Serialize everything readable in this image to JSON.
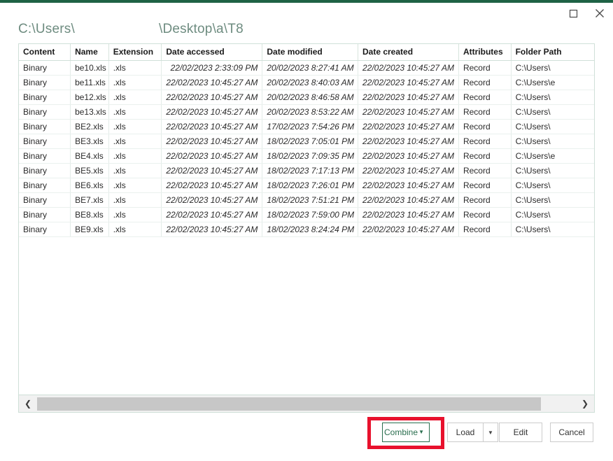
{
  "window": {
    "accent_color": "#1e6245",
    "controls": [
      {
        "name": "maximize",
        "icon": "maximize-icon",
        "label": "Maximize"
      },
      {
        "name": "close",
        "icon": "close-icon",
        "label": "Close"
      }
    ]
  },
  "dialog": {
    "title_prefix": "C:\\Users\\",
    "title_redacted": "",
    "title_suffix": "\\Desktop\\a\\T8",
    "title_color": "#6e8c80"
  },
  "table": {
    "columns": [
      "Content",
      "Name",
      "Extension",
      "Date accessed",
      "Date modified",
      "Date created",
      "Attributes",
      "Folder Path"
    ],
    "rows": [
      {
        "content": "Binary",
        "name": "be10.xls",
        "extension": ".xls",
        "date_accessed": "22/02/2023 2:33:09 PM",
        "date_modified": "20/02/2023 8:27:41 AM",
        "date_created": "22/02/2023 10:45:27 AM",
        "attributes": "Record",
        "folder_path": "C:\\Users\\"
      },
      {
        "content": "Binary",
        "name": "be11.xls",
        "extension": ".xls",
        "date_accessed": "22/02/2023 10:45:27 AM",
        "date_modified": "20/02/2023 8:40:03 AM",
        "date_created": "22/02/2023 10:45:27 AM",
        "attributes": "Record",
        "folder_path": "C:\\Users\\e"
      },
      {
        "content": "Binary",
        "name": "be12.xls",
        "extension": ".xls",
        "date_accessed": "22/02/2023 10:45:27 AM",
        "date_modified": "20/02/2023 8:46:58 AM",
        "date_created": "22/02/2023 10:45:27 AM",
        "attributes": "Record",
        "folder_path": "C:\\Users\\"
      },
      {
        "content": "Binary",
        "name": "be13.xls",
        "extension": ".xls",
        "date_accessed": "22/02/2023 10:45:27 AM",
        "date_modified": "20/02/2023 8:53:22 AM",
        "date_created": "22/02/2023 10:45:27 AM",
        "attributes": "Record",
        "folder_path": "C:\\Users\\"
      },
      {
        "content": "Binary",
        "name": "BE2.xls",
        "extension": ".xls",
        "date_accessed": "22/02/2023 10:45:27 AM",
        "date_modified": "17/02/2023 7:54:26 PM",
        "date_created": "22/02/2023 10:45:27 AM",
        "attributes": "Record",
        "folder_path": "C:\\Users\\"
      },
      {
        "content": "Binary",
        "name": "BE3.xls",
        "extension": ".xls",
        "date_accessed": "22/02/2023 10:45:27 AM",
        "date_modified": "18/02/2023 7:05:01 PM",
        "date_created": "22/02/2023 10:45:27 AM",
        "attributes": "Record",
        "folder_path": "C:\\Users\\"
      },
      {
        "content": "Binary",
        "name": "BE4.xls",
        "extension": ".xls",
        "date_accessed": "22/02/2023 10:45:27 AM",
        "date_modified": "18/02/2023 7:09:35 PM",
        "date_created": "22/02/2023 10:45:27 AM",
        "attributes": "Record",
        "folder_path": "C:\\Users\\e"
      },
      {
        "content": "Binary",
        "name": "BE5.xls",
        "extension": ".xls",
        "date_accessed": "22/02/2023 10:45:27 AM",
        "date_modified": "18/02/2023 7:17:13 PM",
        "date_created": "22/02/2023 10:45:27 AM",
        "attributes": "Record",
        "folder_path": "C:\\Users\\"
      },
      {
        "content": "Binary",
        "name": "BE6.xls",
        "extension": ".xls",
        "date_accessed": "22/02/2023 10:45:27 AM",
        "date_modified": "18/02/2023 7:26:01 PM",
        "date_created": "22/02/2023 10:45:27 AM",
        "attributes": "Record",
        "folder_path": "C:\\Users\\"
      },
      {
        "content": "Binary",
        "name": "BE7.xls",
        "extension": ".xls",
        "date_accessed": "22/02/2023 10:45:27 AM",
        "date_modified": "18/02/2023 7:51:21 PM",
        "date_created": "22/02/2023 10:45:27 AM",
        "attributes": "Record",
        "folder_path": "C:\\Users\\"
      },
      {
        "content": "Binary",
        "name": "BE8.xls",
        "extension": ".xls",
        "date_accessed": "22/02/2023 10:45:27 AM",
        "date_modified": "18/02/2023 7:59:00 PM",
        "date_created": "22/02/2023 10:45:27 AM",
        "attributes": "Record",
        "folder_path": "C:\\Users\\"
      },
      {
        "content": "Binary",
        "name": "BE9.xls",
        "extension": ".xls",
        "date_accessed": "22/02/2023 10:45:27 AM",
        "date_modified": "18/02/2023 8:24:24 PM",
        "date_created": "22/02/2023 10:45:27 AM",
        "attributes": "Record",
        "folder_path": "C:\\Users\\"
      }
    ]
  },
  "scrollbar": {
    "left_arrow": "❮",
    "right_arrow": "❯"
  },
  "footer": {
    "combine_label": "Combine",
    "combine_caret": "▼",
    "combine_color": "#2a6e4e",
    "load_label": "Load",
    "load_caret": "▼",
    "edit_label": "Edit",
    "cancel_label": "Cancel"
  },
  "annotation": {
    "color": "#e8112d",
    "target": "combine-button"
  }
}
